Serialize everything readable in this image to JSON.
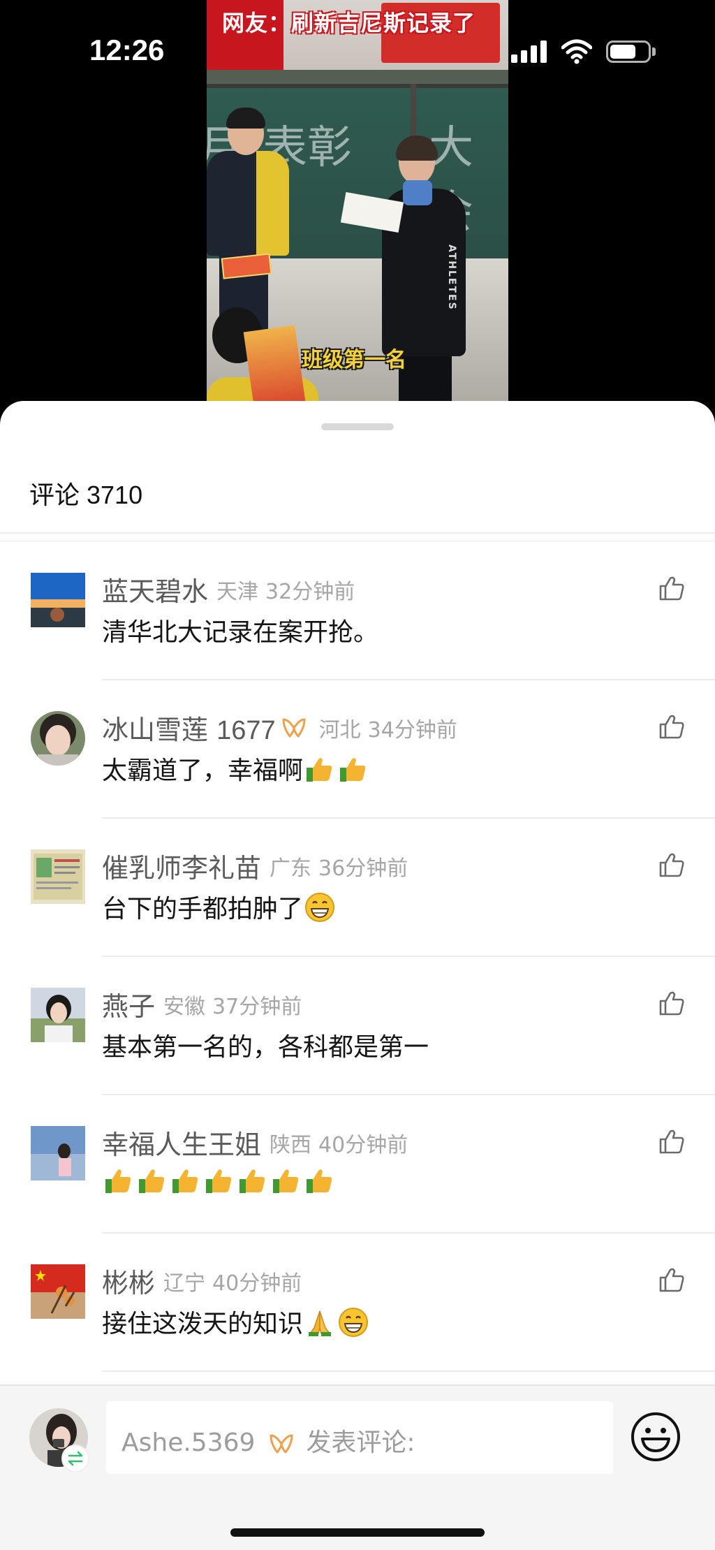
{
  "status_bar": {
    "time": "12:26"
  },
  "video": {
    "overlay_title": "网友：刷新吉尼斯记录了",
    "caption": "班级第一名",
    "chalkboard_text": [
      "月",
      "表彰",
      "大会"
    ],
    "jacket_text": "ATHLETES"
  },
  "comments_panel": {
    "title": "评论",
    "count": "3710",
    "items": [
      {
        "name": "蓝天碧水",
        "location": "天津",
        "time": "32分钟前",
        "text": "清华北大记录在案开抢。",
        "emojis": []
      },
      {
        "name": "冰山雪莲",
        "name_num": "1677",
        "vip": true,
        "location": "河北",
        "time": "34分钟前",
        "text": "太霸道了，幸福啊",
        "emojis": [
          "thumbs-up",
          "thumbs-up"
        ]
      },
      {
        "name": "催乳师李礼苗",
        "location": "广东",
        "time": "36分钟前",
        "text": "台下的手都拍肿了",
        "emojis": [
          "grin"
        ]
      },
      {
        "name": "燕子",
        "location": "安徽",
        "time": "37分钟前",
        "text": "基本第一名的，各科都是第一",
        "emojis": []
      },
      {
        "name": "幸福人生王姐",
        "location": "陕西",
        "time": "40分钟前",
        "text": "",
        "emojis": [
          "thumbs-up",
          "thumbs-up",
          "thumbs-up",
          "thumbs-up",
          "thumbs-up",
          "thumbs-up",
          "thumbs-up"
        ]
      },
      {
        "name": "彬彬",
        "location": "辽宁",
        "time": "40分钟前",
        "text": "接住这泼天的知识",
        "emojis": [
          "pray",
          "grin"
        ]
      }
    ]
  },
  "input_bar": {
    "username": "Ashe.5369",
    "placeholder": "发表评论:"
  },
  "colors": {
    "accent_vip": "#f0a04b",
    "meta_gray": "#a6a6a6",
    "name_gray": "#5a5a5a"
  }
}
